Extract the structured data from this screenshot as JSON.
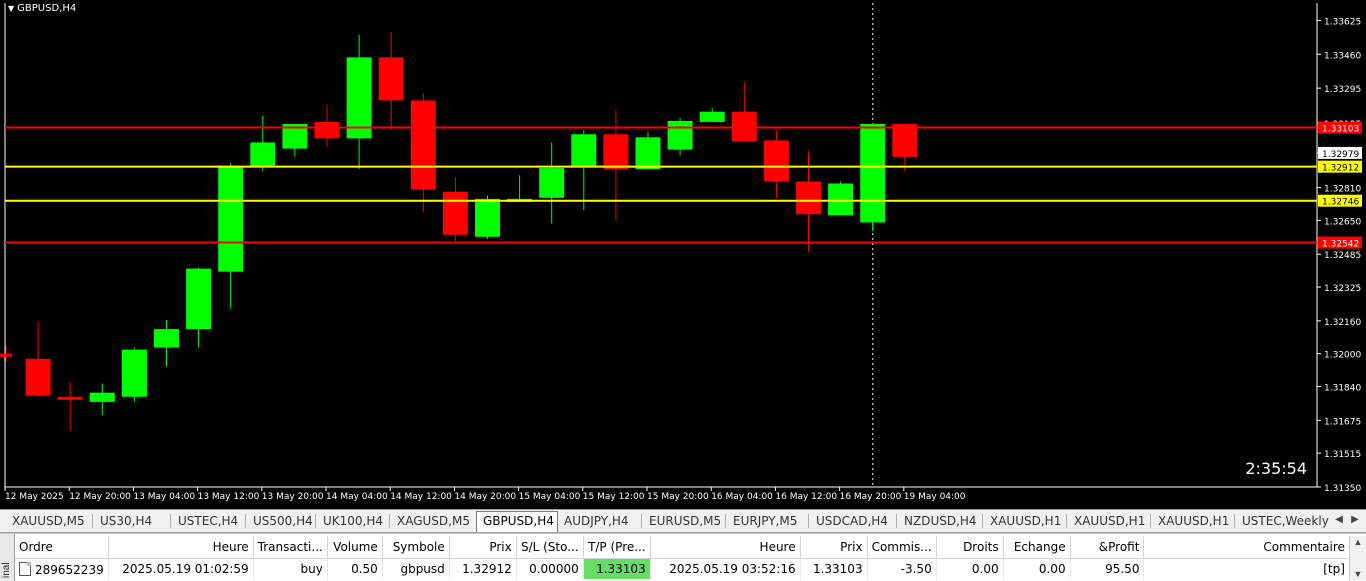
{
  "chart": {
    "title": "GBPUSD,H4",
    "countdown": "2:35:54",
    "y_ticks": [
      "1.33625",
      "1.33460",
      "1.33295",
      "1.33125",
      "1.32979",
      "1.32810",
      "1.32650",
      "1.32485",
      "1.32325",
      "1.32160",
      "1.32000",
      "1.31840",
      "1.31675",
      "1.31515",
      "1.31350"
    ],
    "price_labels": [
      {
        "text": "1.33103",
        "color": "#ff0000",
        "text_color": "#ffffff"
      },
      {
        "text": "1.32979",
        "color": "#ffffff",
        "text_color": "#000000"
      },
      {
        "text": "1.32912",
        "color": "#ffff00",
        "text_color": "#000000"
      },
      {
        "text": "1.32746",
        "color": "#ffff00",
        "text_color": "#000000"
      },
      {
        "text": "1.32542",
        "color": "#ff0000",
        "text_color": "#ffffff"
      }
    ],
    "x_ticks": [
      "12 May 2025",
      "12 May 20:00",
      "13 May 04:00",
      "13 May 12:00",
      "13 May 20:00",
      "14 May 04:00",
      "14 May 12:00",
      "14 May 20:00",
      "15 May 04:00",
      "15 May 12:00",
      "15 May 20:00",
      "16 May 04:00",
      "16 May 12:00",
      "16 May 20:00",
      "19 May 04:00"
    ],
    "colors": {
      "bull": "#00ff00",
      "bear": "#ff0000",
      "background": "#000000",
      "axis": "#ffffff"
    }
  },
  "chart_data": {
    "type": "candlestick",
    "symbol": "GBPUSD",
    "timeframe": "H4",
    "ylim": [
      1.3135,
      1.3371
    ],
    "candles": [
      {
        "o": 1.32,
        "h": 1.3204,
        "l": 1.3196,
        "c": 1.3199
      },
      {
        "o": 1.31975,
        "h": 1.32155,
        "l": 1.31785,
        "c": 1.31795
      },
      {
        "o": 1.3179,
        "h": 1.3186,
        "l": 1.31625,
        "c": 1.3178
      },
      {
        "o": 1.31765,
        "h": 1.31855,
        "l": 1.317,
        "c": 1.3181
      },
      {
        "o": 1.3179,
        "h": 1.3203,
        "l": 1.31765,
        "c": 1.3202
      },
      {
        "o": 1.3203,
        "h": 1.32165,
        "l": 1.3194,
        "c": 1.3212
      },
      {
        "o": 1.3212,
        "h": 1.3242,
        "l": 1.3203,
        "c": 1.32415
      },
      {
        "o": 1.324,
        "h": 1.3293,
        "l": 1.3222,
        "c": 1.3291
      },
      {
        "o": 1.3291,
        "h": 1.3316,
        "l": 1.3289,
        "c": 1.3303
      },
      {
        "o": 1.33,
        "h": 1.3312,
        "l": 1.3296,
        "c": 1.3312
      },
      {
        "o": 1.3313,
        "h": 1.33215,
        "l": 1.3301,
        "c": 1.3305
      },
      {
        "o": 1.3305,
        "h": 1.33555,
        "l": 1.329,
        "c": 1.33445
      },
      {
        "o": 1.33445,
        "h": 1.3357,
        "l": 1.3309,
        "c": 1.33235
      },
      {
        "o": 1.33235,
        "h": 1.3327,
        "l": 1.3269,
        "c": 1.328
      },
      {
        "o": 1.3279,
        "h": 1.3286,
        "l": 1.3255,
        "c": 1.3258
      },
      {
        "o": 1.3257,
        "h": 1.3277,
        "l": 1.3256,
        "c": 1.32755
      },
      {
        "o": 1.32745,
        "h": 1.3287,
        "l": 1.32745,
        "c": 1.32755
      },
      {
        "o": 1.3276,
        "h": 1.3303,
        "l": 1.32635,
        "c": 1.32905
      },
      {
        "o": 1.3291,
        "h": 1.3309,
        "l": 1.327,
        "c": 1.3307
      },
      {
        "o": 1.3307,
        "h": 1.3319,
        "l": 1.3265,
        "c": 1.329
      },
      {
        "o": 1.329,
        "h": 1.3308,
        "l": 1.329,
        "c": 1.33055
      },
      {
        "o": 1.32995,
        "h": 1.3315,
        "l": 1.32965,
        "c": 1.33135
      },
      {
        "o": 1.3313,
        "h": 1.332,
        "l": 1.3313,
        "c": 1.3318
      },
      {
        "o": 1.3318,
        "h": 1.33325,
        "l": 1.3304,
        "c": 1.33035
      },
      {
        "o": 1.3304,
        "h": 1.3309,
        "l": 1.3276,
        "c": 1.3284
      },
      {
        "o": 1.3284,
        "h": 1.3299,
        "l": 1.325,
        "c": 1.3268
      },
      {
        "o": 1.32675,
        "h": 1.3284,
        "l": 1.32675,
        "c": 1.3283
      },
      {
        "o": 1.3264,
        "h": 1.33125,
        "l": 1.326,
        "c": 1.3312
      },
      {
        "o": 1.3312,
        "h": 1.3312,
        "l": 1.3289,
        "c": 1.3296
      }
    ],
    "horizontal_lines": [
      {
        "price": 1.33103,
        "color": "#ff0000"
      },
      {
        "price": 1.32912,
        "color": "#ffff00"
      },
      {
        "price": 1.32746,
        "color": "#ffff00"
      },
      {
        "price": 1.32542,
        "color": "#ff0000"
      }
    ],
    "crosshair_label": "19 May 04:00"
  },
  "tabs": [
    {
      "label": "XAUUSD,M5",
      "active": false
    },
    {
      "label": "US30,H4",
      "active": false
    },
    {
      "label": "USTEC,H4",
      "active": false
    },
    {
      "label": "US500,H4",
      "active": false
    },
    {
      "label": "UK100,H4",
      "active": false
    },
    {
      "label": "XAGUSD,M5",
      "active": false
    },
    {
      "label": "GBPUSD,H4",
      "active": true
    },
    {
      "label": "AUDJPY,H4",
      "active": false
    },
    {
      "label": "EURUSD,M5",
      "active": false
    },
    {
      "label": "EURJPY,M5",
      "active": false
    },
    {
      "label": "USDCAD,H4",
      "active": false
    },
    {
      "label": "NZDUSD,H4",
      "active": false
    },
    {
      "label": "XAUUSD,H1",
      "active": false
    },
    {
      "label": "XAUUSD,H1",
      "active": false
    },
    {
      "label": "XAUUSD,H1",
      "active": false
    },
    {
      "label": "USTEC,Weekly",
      "active": false
    }
  ],
  "terminal": {
    "side_label": "inal",
    "columns": [
      "Ordre",
      "Heure",
      "Transacti...",
      "Volume",
      "Symbole",
      "Prix",
      "S/L (Sto...",
      "T/P (Pre...",
      "Heure",
      "Prix",
      "Commis...",
      "Droits",
      "Echange",
      "&Profit",
      "Commentaire",
      "/"
    ],
    "rows": [
      [
        "289652239",
        "2025.05.19 01:02:59",
        "buy",
        "0.50",
        "gbpusd",
        "1.32912",
        "0.00000",
        "1.33103",
        "2025.05.19 03:52:16",
        "1.33103",
        "-3.50",
        "0.00",
        "0.00",
        "95.50",
        "[tp]"
      ]
    ]
  }
}
